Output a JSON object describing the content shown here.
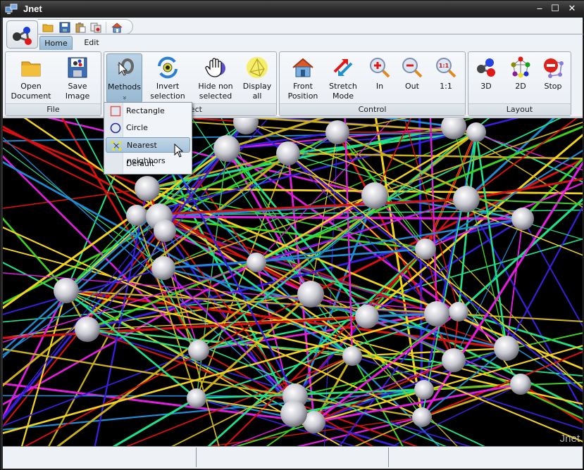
{
  "window": {
    "title": "Jnet",
    "controls": {
      "minimize": "‒",
      "maximize": "☐",
      "close": "✕"
    }
  },
  "quick_access": [
    {
      "name": "open-folder-icon",
      "tooltip": ""
    },
    {
      "name": "save-disk-icon",
      "tooltip": ""
    },
    {
      "name": "paste-clipboard-icon",
      "tooltip": ""
    },
    {
      "name": "copy-image-icon",
      "tooltip": ""
    },
    {
      "name": "home-icon",
      "tooltip": ""
    }
  ],
  "tabs": [
    {
      "label": "Home",
      "active": true
    },
    {
      "label": "Edit",
      "active": false
    }
  ],
  "ribbon": {
    "groups": [
      {
        "label": "File",
        "buttons": [
          {
            "label1": "Open",
            "label2": "Document",
            "icon": "folder-icon"
          },
          {
            "label1": "Save",
            "label2": "Image",
            "icon": "save-image-icon"
          }
        ]
      },
      {
        "label": "Select",
        "buttons": [
          {
            "label1": "Methods",
            "label2": "»",
            "icon": "methods-cursor-icon",
            "pressed": true
          },
          {
            "label1": "Invert",
            "label2": "selection",
            "icon": "invert-selection-icon"
          },
          {
            "label1": "Hide non",
            "label2": "selected",
            "icon": "hand-icon"
          },
          {
            "label1": "Display",
            "label2": "all",
            "icon": "display-all-icon"
          }
        ]
      },
      {
        "label": "Control",
        "buttons": [
          {
            "label1": "Front",
            "label2": "Position",
            "icon": "house-icon"
          },
          {
            "label1": "Stretch",
            "label2": "Mode",
            "icon": "stretch-arrows-icon"
          },
          {
            "label1": "In",
            "label2": "",
            "icon": "zoom-in-icon"
          },
          {
            "label1": "Out",
            "label2": "",
            "icon": "zoom-out-icon"
          },
          {
            "label1": "1:1",
            "label2": "",
            "icon": "zoom-actual-icon"
          }
        ]
      },
      {
        "label": "Layout",
        "buttons": [
          {
            "label1": "3D",
            "label2": "",
            "icon": "molecule-3d-icon"
          },
          {
            "label1": "2D",
            "label2": "",
            "icon": "graph-2d-icon"
          },
          {
            "label1": "Stop",
            "label2": "",
            "icon": "stop-icon"
          }
        ]
      }
    ]
  },
  "methods_menu": {
    "items": [
      {
        "label": "Rectangle",
        "icon": "rectangle-icon"
      },
      {
        "label": "Circle",
        "icon": "circle-icon"
      },
      {
        "label": "Nearest neighbors",
        "icon": "nearest-neighbors-icon",
        "highlighted": true
      },
      {
        "label": "Default",
        "icon": ""
      }
    ]
  },
  "canvas": {
    "watermark": "Jnet",
    "background": "#000000",
    "edge_colors": [
      "#f2d21b",
      "#1f8ad6",
      "#e21de0",
      "#d81010",
      "#3fd11f",
      "#3a1ee0",
      "#c9b01a",
      "#1fe08a"
    ]
  },
  "statusbar": {
    "cells": [
      "",
      "",
      ""
    ]
  }
}
